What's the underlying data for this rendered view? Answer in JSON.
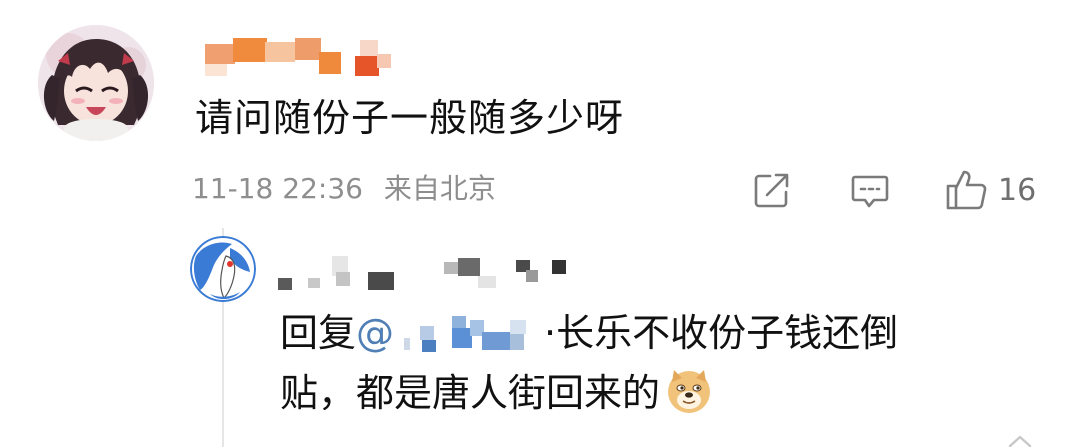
{
  "comment": {
    "text": "请问随份子一般随多少呀",
    "timestamp": "11-18 22:36",
    "location": "来自北京",
    "like_count": "16",
    "icons": {
      "avatar": "anime-girl-avatar",
      "share": "share-icon",
      "reply": "comment-icon",
      "like": "thumbs-up-icon"
    }
  },
  "reply": {
    "prefix": "回复",
    "mention_at": "@",
    "separator": "·",
    "line1_rest": "长乐不收份子钱还倒",
    "line2": "贴，都是唐人街回来的",
    "emoji": "doge-emoji",
    "icons": {
      "avatar": "map-avatar"
    }
  },
  "colors": {
    "text_primary": "#111111",
    "text_meta": "#8e8e8e",
    "icon_gray": "#7a7a7a",
    "mention_blue": "#4f7fb5",
    "blur_orange": "#f08a3c",
    "blur_blue": "#5b8fd6"
  }
}
